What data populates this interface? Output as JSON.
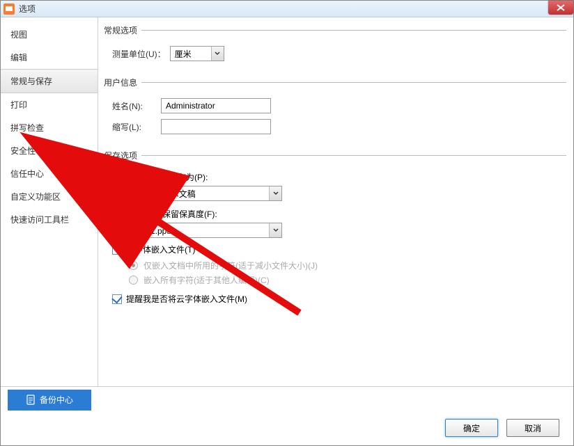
{
  "window": {
    "title": "选项"
  },
  "sidebar": {
    "items": [
      {
        "label": "视图"
      },
      {
        "label": "编辑"
      },
      {
        "label": "常规与保存"
      },
      {
        "label": "打印"
      },
      {
        "label": "拼写检查"
      },
      {
        "label": "安全性"
      },
      {
        "label": "信任中心"
      },
      {
        "label": "自定义功能区"
      },
      {
        "label": "快速访问工具栏"
      }
    ],
    "selected_index": 2
  },
  "sections": {
    "general": {
      "legend": "常规选项",
      "unit_label": "测量单位(U)：",
      "unit_value": "厘米"
    },
    "user": {
      "legend": "用户信息",
      "name_label": "姓名(N):",
      "name_value": "Administrator",
      "abbrev_label": "缩写(L):",
      "abbrev_value": ""
    },
    "save": {
      "legend": "保存选项",
      "save_as_label": "将 WPS演示 文件存为(P):",
      "save_as_value": "PowerPoint 演示文稿",
      "share_label": "共享该文档时保留保真度(F):",
      "share_doc_value": "演示文稿1.pptx",
      "embed_fonts_label": "将字体嵌入文件(T)",
      "embed_fonts_checked": false,
      "radio_used_chars_label": "仅嵌入文档中所用的字符(适于减小文件大小)(J)",
      "radio_all_chars_label": "嵌入所有字符(适于其他人编辑)(C)",
      "remind_cloud_label": "提醒我是否将云字体嵌入文件(M)",
      "remind_cloud_checked": true
    }
  },
  "footer": {
    "backup_center": "备份中心",
    "ok": "确定",
    "cancel": "取消"
  }
}
